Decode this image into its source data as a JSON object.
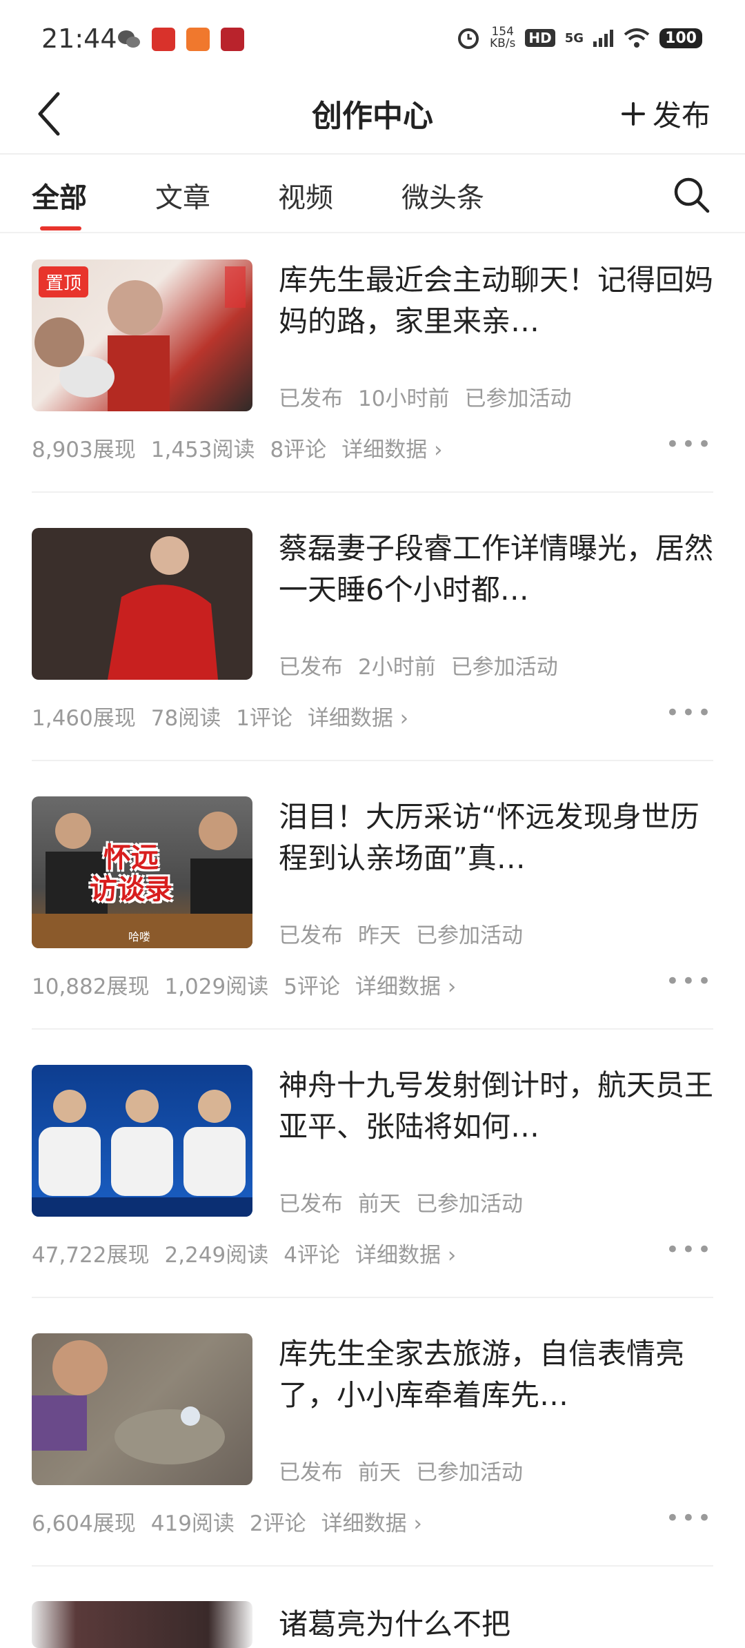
{
  "status_bar": {
    "time": "21:44",
    "net_speed_value": "154",
    "net_speed_unit": "KB/s",
    "hd": "HD",
    "network": "5G",
    "battery": "100",
    "icons": [
      "wechat-icon",
      "app-icon-red",
      "app-icon-orange",
      "bank-icon",
      "alarm-icon",
      "wifi-icon",
      "signal-icon"
    ]
  },
  "header": {
    "title": "创作中心",
    "publish_label": "发布"
  },
  "tabs": [
    {
      "label": "全部",
      "active": true
    },
    {
      "label": "文章",
      "active": false
    },
    {
      "label": "视频",
      "active": false
    },
    {
      "label": "微头条",
      "active": false
    }
  ],
  "colors": {
    "accent": "#e8342c",
    "muted_text": "#9a9a9a"
  },
  "articles": [
    {
      "title": "库先生最近会主动聊天！记得回妈妈的路，家里来亲…",
      "pinned_label": "置顶",
      "status": "已发布",
      "time": "10小时前",
      "activity": "已参加活动",
      "views": "8,903展现",
      "reads": "1,453阅读",
      "comments": "8评论",
      "detail": "详细数据"
    },
    {
      "title": "蔡磊妻子段睿工作详情曝光，居然一天睡6个小时都…",
      "status": "已发布",
      "time": "2小时前",
      "activity": "已参加活动",
      "views": "1,460展现",
      "reads": "78阅读",
      "comments": "1评论",
      "detail": "详细数据"
    },
    {
      "title": "泪目！大厉采访“怀远发现身世历程到认亲场面”真…",
      "thumb_text_1": "怀远",
      "thumb_text_2": "访谈录",
      "thumb_caption": "哈喽",
      "status": "已发布",
      "time": "昨天",
      "activity": "已参加活动",
      "views": "10,882展现",
      "reads": "1,029阅读",
      "comments": "5评论",
      "detail": "详细数据"
    },
    {
      "title": "神舟十九号发射倒计时，航天员王亚平、张陆将如何…",
      "status": "已发布",
      "time": "前天",
      "activity": "已参加活动",
      "views": "47,722展现",
      "reads": "2,249阅读",
      "comments": "4评论",
      "detail": "详细数据"
    },
    {
      "title": "库先生全家去旅游，自信表情亮了，小小库牵着库先…",
      "status": "已发布",
      "time": "前天",
      "activity": "已参加活动",
      "views": "6,604展现",
      "reads": "419阅读",
      "comments": "2评论",
      "detail": "详细数据"
    },
    {
      "title": "诸葛亮为什么不把"
    }
  ]
}
